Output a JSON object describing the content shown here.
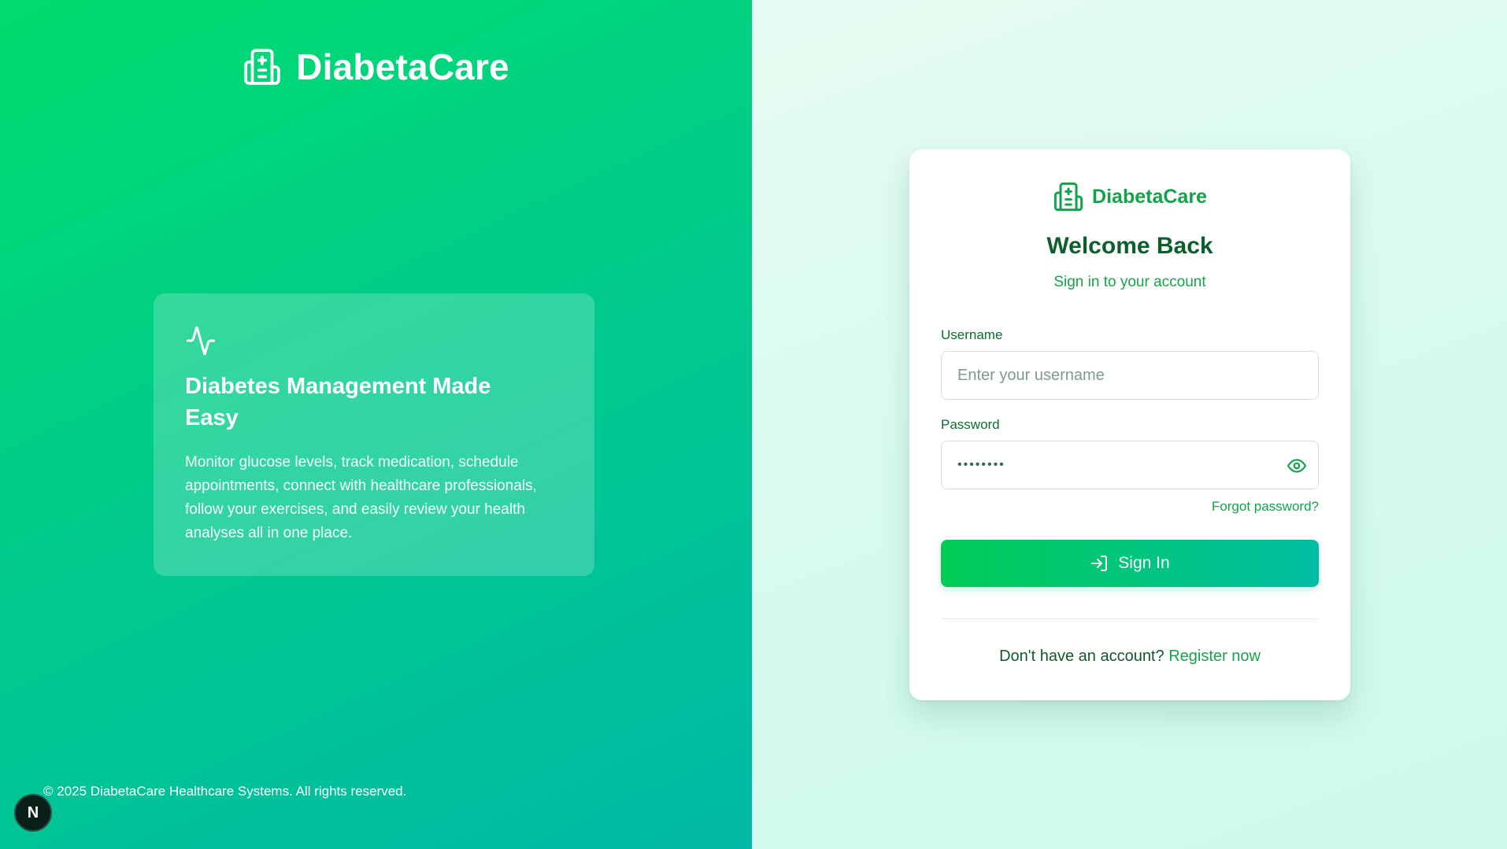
{
  "brand": {
    "name": "DiabetaCare",
    "icon": "hospital-icon"
  },
  "feature": {
    "icon": "activity-pulse-icon",
    "title": "Diabetes Management Made Easy",
    "description": "Monitor glucose levels, track medication, schedule appointments, connect with healthcare professionals, follow your exercises, and easily review your health analyses all in one place."
  },
  "footer": {
    "copyright": "© 2025 DiabetaCare Healthcare Systems. All rights reserved."
  },
  "dev_badge": {
    "label": "N"
  },
  "login": {
    "brand_name": "DiabetaCare",
    "title": "Welcome Back",
    "subtitle": "Sign in to your account",
    "username_label": "Username",
    "username_placeholder": "Enter your username",
    "username_value": "",
    "password_label": "Password",
    "password_value": "••••••••",
    "forgot_password": "Forgot password?",
    "signin_button": "Sign In",
    "register_prompt": "Don't have an account?",
    "register_link": "Register now"
  },
  "colors": {
    "primary_green": "#00d46a",
    "teal": "#00bfa6",
    "dark_green_text": "#0b5f2c",
    "link_green": "#17a24b"
  }
}
